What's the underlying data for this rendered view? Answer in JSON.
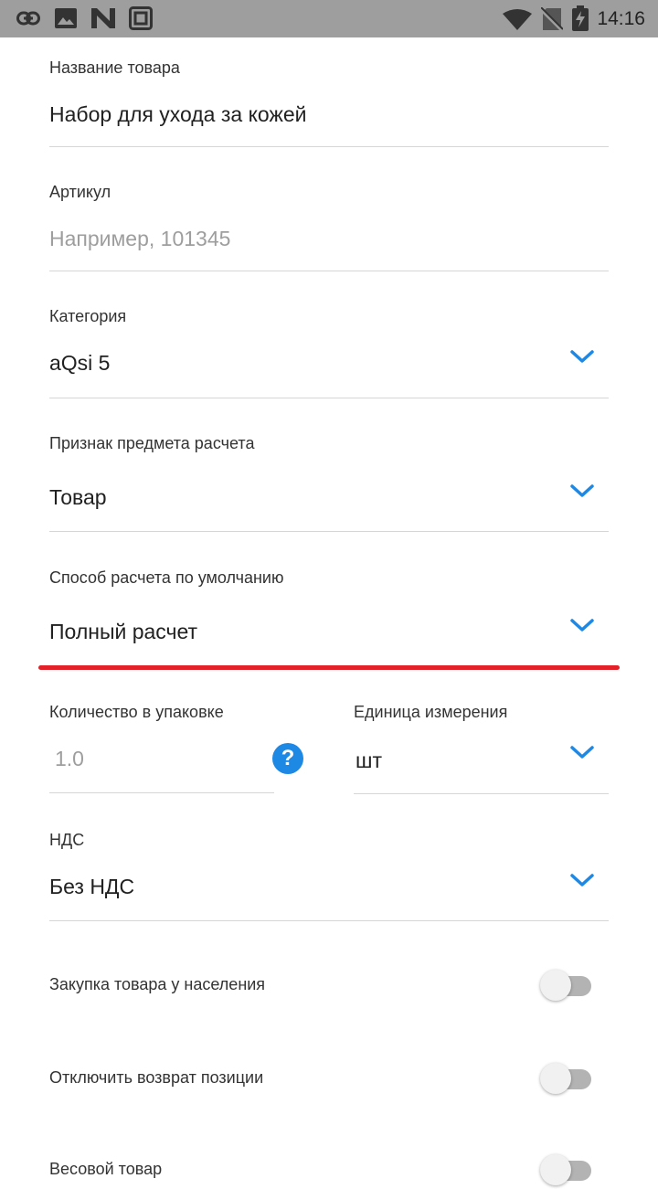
{
  "status_bar": {
    "time": "14:16",
    "left_icons": [
      "link-icon",
      "image-icon",
      "n-logo-icon",
      "screenshot-icon"
    ],
    "right_icons": [
      "wifi-icon",
      "no-sim-icon",
      "battery-icon"
    ]
  },
  "form": {
    "product_name": {
      "label": "Название товара",
      "value": "Набор для ухода за кожей"
    },
    "article": {
      "label": "Артикул",
      "placeholder": "Например, 101345"
    },
    "category": {
      "label": "Категория",
      "value": "aQsi 5"
    },
    "payment_subject": {
      "label": "Признак предмета расчета",
      "value": "Товар"
    },
    "payment_method": {
      "label": "Способ расчета по умолчанию",
      "value": "Полный расчет"
    },
    "quantity": {
      "label": "Количество в упаковке",
      "placeholder": "1.0",
      "help": "?"
    },
    "unit": {
      "label": "Единица измерения",
      "value": "шт"
    },
    "vat": {
      "label": "НДС",
      "value": "Без НДС"
    }
  },
  "switches": [
    {
      "label": "Закупка товара у населения",
      "on": false
    },
    {
      "label": "Отключить возврат позиции",
      "on": false
    },
    {
      "label": "Весовой товар",
      "on": false
    }
  ],
  "colors": {
    "accent": "#1e88e5",
    "highlight_line": "#e32128",
    "status_bar": "#9e9e9e"
  }
}
